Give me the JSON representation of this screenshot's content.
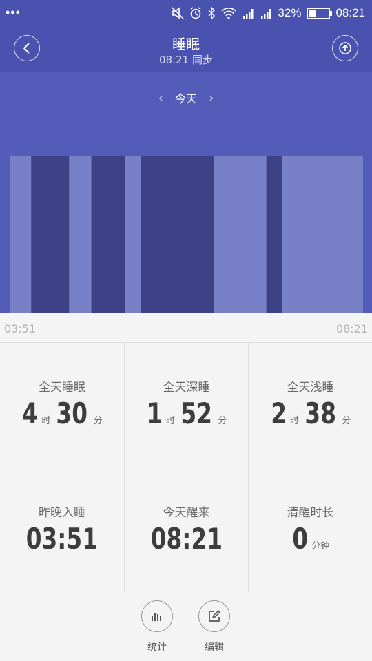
{
  "status_bar": {
    "menu_dots": "•••",
    "battery_percent": "32%",
    "battery_level": 0.32,
    "time": "08:21"
  },
  "header": {
    "title": "睡眠",
    "sync_text": "08:21 同步"
  },
  "date_nav": {
    "prev": "‹",
    "label": "今天",
    "next": "›"
  },
  "colors": {
    "chart_bg": "#545cba",
    "deep": "#3c4285",
    "light": "#7880c8"
  },
  "chart_data": {
    "type": "bar",
    "x_start": "03:51",
    "x_end": "08:21",
    "segments": [
      {
        "stage": "light",
        "start": "03:51",
        "end": "04:07"
      },
      {
        "stage": "deep",
        "start": "04:07",
        "end": "04:36"
      },
      {
        "stage": "light",
        "start": "04:36",
        "end": "04:53"
      },
      {
        "stage": "deep",
        "start": "04:53",
        "end": "05:19"
      },
      {
        "stage": "light",
        "start": "05:19",
        "end": "05:31"
      },
      {
        "stage": "deep",
        "start": "05:31",
        "end": "06:27"
      },
      {
        "stage": "light",
        "start": "06:27",
        "end": "07:07"
      },
      {
        "stage": "deep",
        "start": "07:07",
        "end": "07:19"
      },
      {
        "stage": "light",
        "start": "07:19",
        "end": "08:21"
      }
    ]
  },
  "axis": {
    "start_label": "03:51",
    "end_label": "08:21"
  },
  "stats": [
    {
      "label": "全天睡眠",
      "parts": [
        {
          "n": "4",
          "u": "时"
        },
        {
          "n": "30",
          "u": "分"
        }
      ]
    },
    {
      "label": "全天深睡",
      "parts": [
        {
          "n": "1",
          "u": "时"
        },
        {
          "n": "52",
          "u": "分"
        }
      ]
    },
    {
      "label": "全天浅睡",
      "parts": [
        {
          "n": "2",
          "u": "时"
        },
        {
          "n": "38",
          "u": "分"
        }
      ]
    },
    {
      "label": "昨晚入睡",
      "parts": [
        {
          "n": "03:51",
          "u": ""
        }
      ]
    },
    {
      "label": "今天醒来",
      "parts": [
        {
          "n": "08:21",
          "u": ""
        }
      ]
    },
    {
      "label": "清醒时长",
      "parts": [
        {
          "n": "0",
          "u": "分钟"
        }
      ]
    }
  ],
  "bottom": {
    "stats_label": "统计",
    "edit_label": "编辑"
  }
}
